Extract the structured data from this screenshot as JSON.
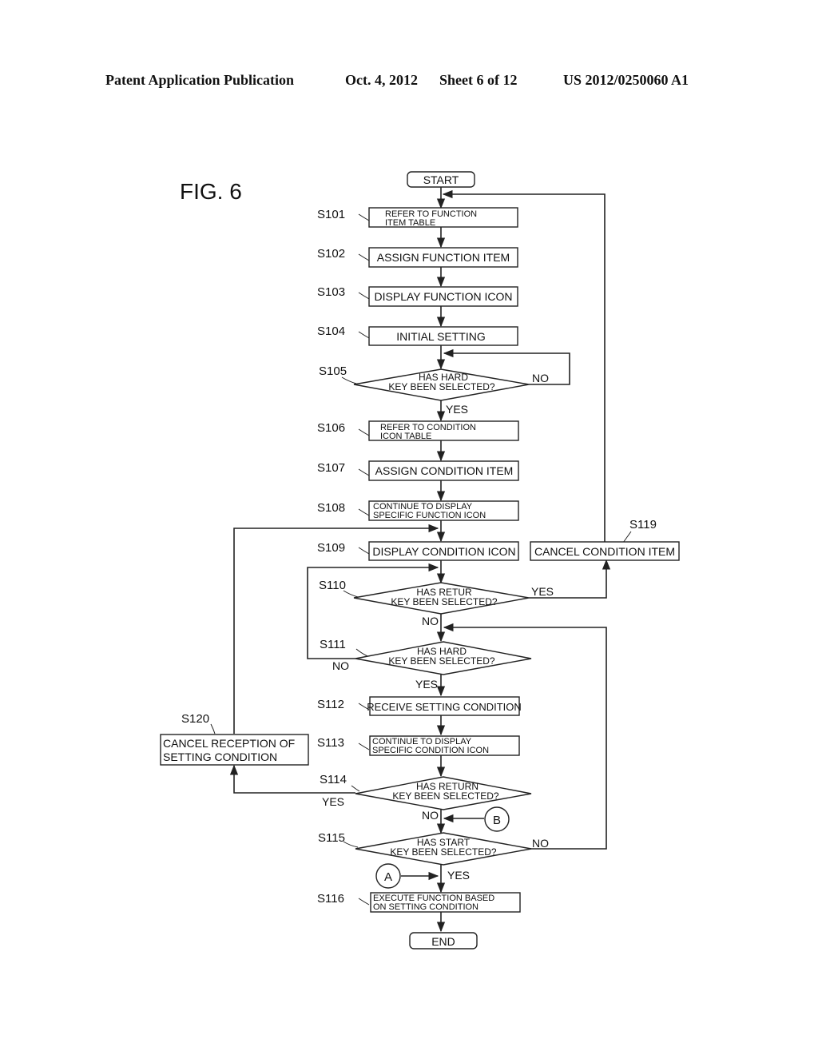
{
  "header": {
    "publication": "Patent Application Publication",
    "date": "Oct. 4, 2012",
    "sheet": "Sheet 6 of 12",
    "number": "US 2012/0250060 A1"
  },
  "figure": {
    "label": "FIG. 6"
  },
  "terminals": {
    "start": "START",
    "end": "END"
  },
  "steps": {
    "S101": {
      "id": "S101",
      "lines": [
        "REFER TO FUNCTION",
        "ITEM TABLE"
      ]
    },
    "S102": {
      "id": "S102",
      "lines": [
        "ASSIGN FUNCTION ITEM"
      ]
    },
    "S103": {
      "id": "S103",
      "lines": [
        "DISPLAY FUNCTION ICON"
      ]
    },
    "S104": {
      "id": "S104",
      "lines": [
        "INITIAL SETTING"
      ]
    },
    "S105": {
      "id": "S105",
      "lines": [
        "HAS HARD",
        "KEY BEEN SELECTED?"
      ]
    },
    "S106": {
      "id": "S106",
      "lines": [
        "REFER TO CONDITION",
        "ICON TABLE"
      ]
    },
    "S107": {
      "id": "S107",
      "lines": [
        "ASSIGN CONDITION ITEM"
      ]
    },
    "S108": {
      "id": "S108",
      "lines": [
        "CONTINUE TO DISPLAY",
        "SPECIFIC FUNCTION ICON"
      ]
    },
    "S109": {
      "id": "S109",
      "lines": [
        "DISPLAY CONDITION ICON"
      ]
    },
    "S110": {
      "id": "S110",
      "lines": [
        "HAS RETUR",
        "KEY BEEN SELECTED?"
      ]
    },
    "S111": {
      "id": "S111",
      "lines": [
        "HAS HARD",
        "KEY BEEN SELECTED?"
      ]
    },
    "S112": {
      "id": "S112",
      "lines": [
        "RECEIVE SETTING CONDITION"
      ]
    },
    "S113": {
      "id": "S113",
      "lines": [
        "CONTINUE TO DISPLAY",
        "SPECIFIC CONDITION ICON"
      ]
    },
    "S114": {
      "id": "S114",
      "lines": [
        "HAS RETURN",
        "KEY BEEN SELECTED?"
      ]
    },
    "S115": {
      "id": "S115",
      "lines": [
        "HAS START",
        "KEY BEEN SELECTED?"
      ]
    },
    "S116": {
      "id": "S116",
      "lines": [
        "EXECUTE FUNCTION BASED",
        "ON SETTING CONDITION"
      ]
    },
    "S119": {
      "id": "S119",
      "lines": [
        "CANCEL CONDITION ITEM"
      ]
    },
    "S120": {
      "id": "S120",
      "lines": [
        "CANCEL RECEPTION OF",
        "SETTING CONDITION"
      ]
    }
  },
  "step_ids": {
    "S101": "S101",
    "S102": "S102",
    "S103": "S103",
    "S104": "S104",
    "S105": "S105",
    "S106": "S106",
    "S107": "S107",
    "S108": "S108",
    "S109": "S109",
    "S110": "S110",
    "S111": "S111",
    "S112": "S112",
    "S113": "S113",
    "S114": "S114",
    "S115": "S115",
    "S116": "S116",
    "S119": "S119",
    "S120": "S120"
  },
  "branch_labels": {
    "s105_no": "NO",
    "s105_yes": "YES",
    "s110_yes": "YES",
    "s110_no": "NO",
    "s111_no": "NO",
    "s111_yes": "YES",
    "s114_yes": "YES",
    "s114_no": "NO",
    "s115_no": "NO",
    "s115_yes": "YES"
  },
  "connectors": {
    "A": "A",
    "B": "B"
  }
}
